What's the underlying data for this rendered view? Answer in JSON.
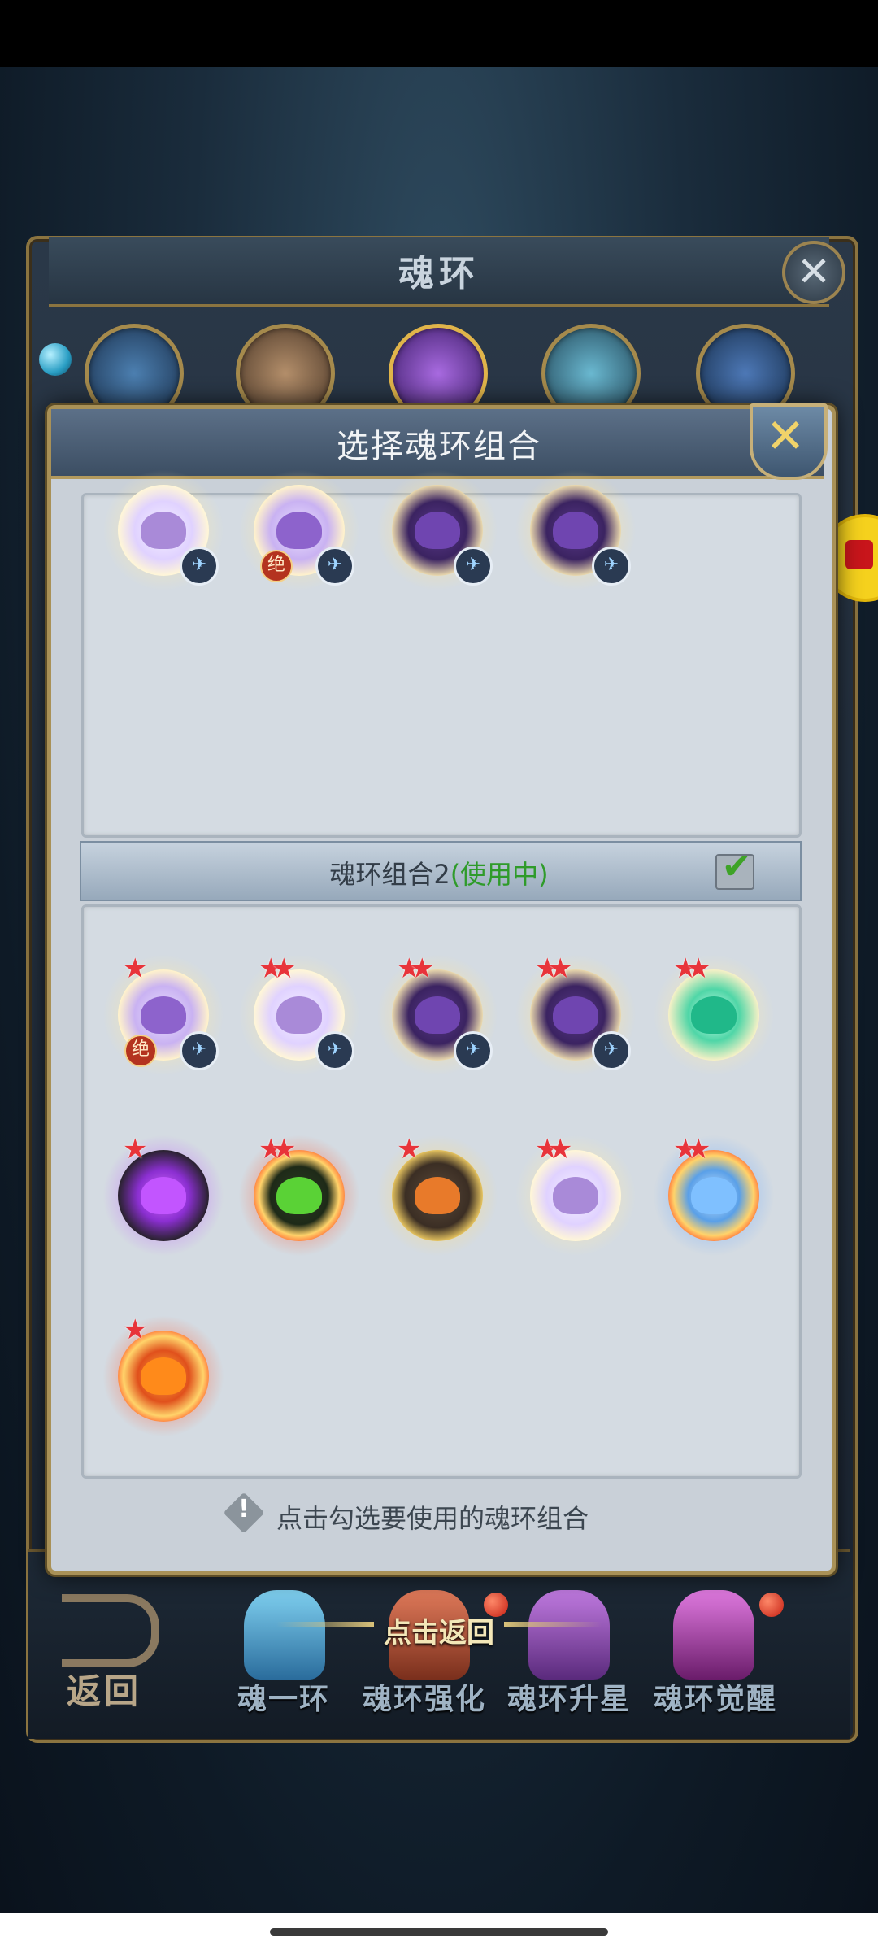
{
  "background_window": {
    "title": "魂环",
    "close_symbol": "✕"
  },
  "modal": {
    "title": "选择魂环组合",
    "close_symbol": "✕",
    "group2": {
      "label": "魂环组合2",
      "status": "(使用中)",
      "checked": true
    },
    "hint": "点击勾选要使用的魂环组合",
    "hint_icon_symbol": "!"
  },
  "group1_rings": [
    {
      "color": "white-purple",
      "badge": "wing"
    },
    {
      "color": "light-purple",
      "badge": "wing",
      "tag": "绝"
    },
    {
      "color": "dark-purple",
      "badge": "wing"
    },
    {
      "color": "dark-purple",
      "badge": "wing"
    }
  ],
  "group2_rings": [
    {
      "color": "light-purple",
      "stars": 1,
      "badge": "wing",
      "tag": "绝"
    },
    {
      "color": "white-purple",
      "stars": 2,
      "badge": "wing"
    },
    {
      "color": "dark-purple",
      "stars": 2,
      "badge": "wing"
    },
    {
      "color": "dark-purple",
      "stars": 2,
      "badge": "wing"
    },
    {
      "color": "green-white",
      "stars": 2
    },
    {
      "color": "black-purple",
      "stars": 1
    },
    {
      "color": "red-green",
      "stars": 2
    },
    {
      "color": "gold-dragon",
      "stars": 1
    },
    {
      "color": "white-purple",
      "stars": 2
    },
    {
      "color": "red-blue",
      "stars": 2
    },
    {
      "color": "red-fire",
      "stars": 1
    }
  ],
  "tag_jue": "绝",
  "wing_symbol": "✈",
  "star_symbol": "★",
  "bottom_nav": {
    "back_label": "返回",
    "tap_back": "点击返回",
    "tabs": [
      "魂一环",
      "魂环强化",
      "魂环升星",
      "魂环觉醒"
    ]
  },
  "colors": {
    "accent_gold": "#a99157",
    "in_use_green": "#2f9b2a",
    "star_red": "#e8343a"
  }
}
